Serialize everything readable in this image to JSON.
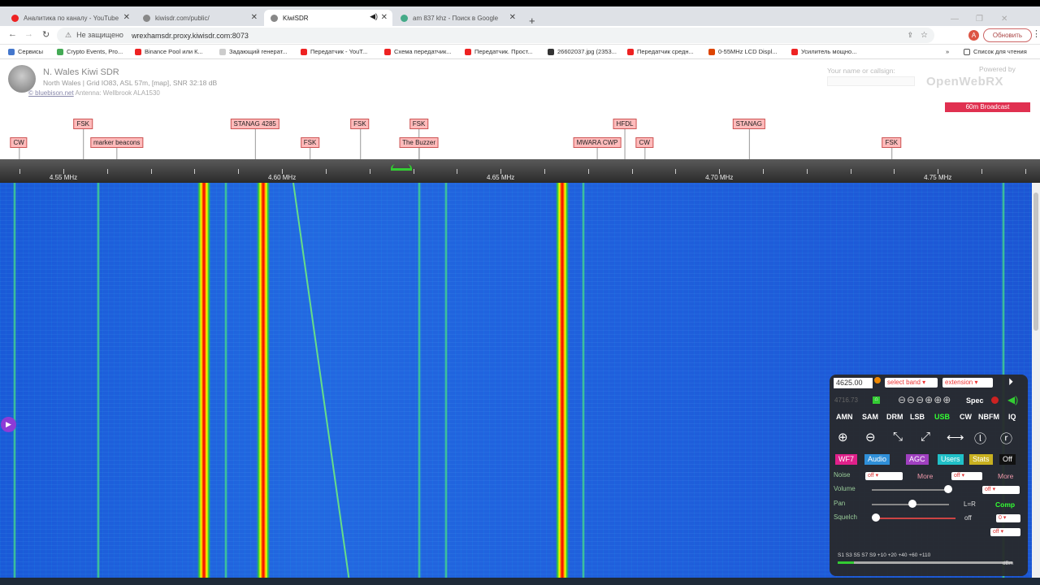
{
  "browser": {
    "tabs": [
      {
        "title": "Аналитика по каналу - YouTube",
        "color": "#e22"
      },
      {
        "title": "kiwisdr.com/public/",
        "color": "#888"
      },
      {
        "title": "KiwiSDR",
        "color": "#888"
      },
      {
        "title": "am 837 khz - Поиск в Google",
        "color": "#4a8"
      }
    ],
    "new_tab": "+",
    "security": "Не защищено",
    "url": "wrexhamsdr.proxy.kiwisdr.com:8073",
    "profile": "A",
    "update_button": "Обновить",
    "bookmarks": [
      {
        "label": "Сервисы",
        "color": "#47c"
      },
      {
        "label": "Crypto Events, Pro...",
        "color": "#4a5"
      },
      {
        "label": "Binance Pool или К...",
        "color": "#e22"
      },
      {
        "label": "Задающий генерат...",
        "color": "#ccc"
      },
      {
        "label": "Передатчик - YouT...",
        "color": "#e22"
      },
      {
        "label": "Схема передатчик...",
        "color": "#e22"
      },
      {
        "label": "Передатчик. Прост...",
        "color": "#e22"
      },
      {
        "label": "26602037.jpg (2353...",
        "color": "#333"
      },
      {
        "label": "Передатчик средн...",
        "color": "#e22"
      },
      {
        "label": "0-55MHz LCD Displ...",
        "color": "#d40"
      },
      {
        "label": "Усилитель мощно...",
        "color": "#e22"
      }
    ],
    "reading_list": "Список для чтения"
  },
  "kiwi": {
    "name": "N. Wales Kiwi SDR",
    "info": "North Wales | Grid IO83, ASL 57m, [map], SNR 32:18 dB",
    "antenna_link": "© bluebison.net",
    "antenna": "Antenna: Wellbrook ALA1530",
    "callsign_placeholder": "Your name or callsign:",
    "powered_by": "Powered by",
    "openwebrx": "OpenWebRX",
    "band_label": "60m Broadcast"
  },
  "stations": [
    {
      "label": "CW",
      "freq": 4.5398,
      "row": 2
    },
    {
      "label": "FSK",
      "freq": 4.5545,
      "row": 1
    },
    {
      "label": "marker beacons",
      "freq": 4.5622,
      "row": 2
    },
    {
      "label": "STANAG 4285",
      "freq": 4.5938,
      "row": 1
    },
    {
      "label": "FSK",
      "freq": 4.6064,
      "row": 2
    },
    {
      "label": "FSK",
      "freq": 4.6178,
      "row": 1
    },
    {
      "label": "FSK",
      "freq": 4.6313,
      "row": 1
    },
    {
      "label": "The Buzzer",
      "freq": 4.6313,
      "row": 2
    },
    {
      "label": "MWARA CWP",
      "freq": 4.6721,
      "row": 2
    },
    {
      "label": "HFDL",
      "freq": 4.6784,
      "row": 1
    },
    {
      "label": "CW",
      "freq": 4.6829,
      "row": 2
    },
    {
      "label": "STANAG",
      "freq": 4.7068,
      "row": 1
    },
    {
      "label": "FSK",
      "freq": 4.7394,
      "row": 2
    }
  ],
  "scale": {
    "ticks": [
      {
        "freq": 4.55,
        "label": "4.55 MHz"
      },
      {
        "freq": 4.6,
        "label": "4.60 MHz"
      },
      {
        "freq": 4.65,
        "label": "4.65 MHz"
      },
      {
        "freq": 4.7,
        "label": "4.70 MHz"
      },
      {
        "freq": 4.75,
        "label": "4.75 MHz"
      }
    ],
    "range_mhz": [
      4.5355,
      4.7715
    ]
  },
  "waterfall_signals": [
    {
      "freq": 4.5822,
      "kind": "strong"
    },
    {
      "freq": 4.5958,
      "kind": "strong"
    },
    {
      "freq": 4.664,
      "kind": "strong"
    },
    {
      "freq": 4.5872,
      "kind": "weak"
    },
    {
      "freq": 4.6313,
      "kind": "weak"
    },
    {
      "freq": 4.6375,
      "kind": "weak"
    },
    {
      "freq": 4.669,
      "kind": "weak"
    },
    {
      "freq": 4.558,
      "kind": "weak"
    },
    {
      "freq": 4.5388,
      "kind": "weak"
    },
    {
      "freq": 4.765,
      "kind": "weak"
    }
  ],
  "panel": {
    "frequency": "4625.00",
    "select_band": "select band",
    "extension": "extension",
    "sub_freq": "4716.73",
    "spec": "Spec",
    "modes": [
      "AMN",
      "SAM",
      "DRM",
      "LSB",
      "USB",
      "CW",
      "NBFM",
      "IQ"
    ],
    "active_mode": "USB",
    "categories": [
      {
        "label": "WF7",
        "color": "#e0208a"
      },
      {
        "label": "Audio",
        "color": "#2f8fd8"
      },
      {
        "label": "AGC",
        "color": "#a040c0"
      },
      {
        "label": "Users",
        "color": "#20c0c8"
      },
      {
        "label": "Stats",
        "color": "#c8b020"
      },
      {
        "label": "Off",
        "color": "#111"
      }
    ],
    "noise_label": "Noise",
    "noise_value": "off",
    "more": "More",
    "more2_value": "off",
    "volume_label": "Volume",
    "volume_value": "off",
    "pan_label": "Pan",
    "pan_lr": "L=R",
    "comp": "Comp",
    "squelch_label": "Squelch",
    "squelch_off": "off",
    "squelch_value": "0",
    "last_value": "off",
    "smeter": "S1  S3  S5  S7  S9 +10 +20  +40  +60 +110",
    "dbm": "dBm"
  }
}
